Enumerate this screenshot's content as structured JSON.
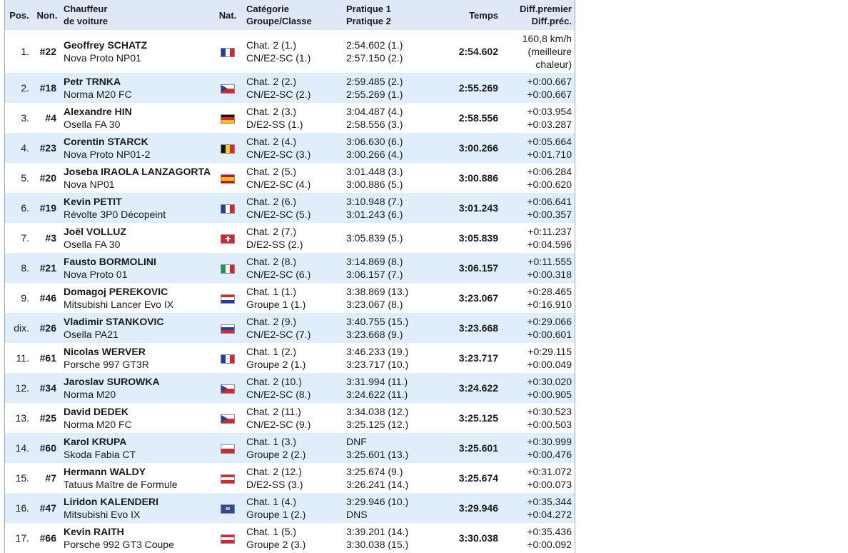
{
  "header": {
    "pos": "Pos.",
    "no": "Non.",
    "driver": "Chauffeur",
    "car": "de voiture",
    "nat": "Nat.",
    "category": "Catégorie",
    "group": "Groupe/Classe",
    "practice1": "Pratique 1",
    "practice2": "Pratique 2",
    "time": "Temps",
    "diff_first": "Diff.premier",
    "diff_prev": "Diff.préc."
  },
  "rows": [
    {
      "pos": "1.",
      "no": "#22",
      "driver": "Geoffrey SCHATZ",
      "car": "Nova Proto NP01",
      "flag": "fr",
      "cat": "Chat. 2 (1.)",
      "group": "CN/E2-SC (1.)",
      "p1": "2:54.602 (1.)",
      "p2": "2:57.150 (2.)",
      "time": "2:54.602",
      "diff1": "160,8 km/h",
      "diff2": "(meilleure",
      "diff3": "chaleur)"
    },
    {
      "pos": "2.",
      "no": "#18",
      "driver": "Petr TRNKA",
      "car": "Norma M20 FC",
      "flag": "cz",
      "cat": "Chat. 2 (2.)",
      "group": "CN/E2-SC (2.)",
      "p1": "2:59.485 (2.)",
      "p2": "2:55.269 (1.)",
      "time": "2:55.269",
      "diff1": "+0:00.667",
      "diff2": "+0:00.667"
    },
    {
      "pos": "3.",
      "no": "#4",
      "driver": "Alexandre HIN",
      "car": "Osella FA 30",
      "flag": "de",
      "cat": "Chat. 2 (3.)",
      "group": "D/E2-SS (1.)",
      "p1": "3:04.487 (4.)",
      "p2": "2:58.556 (3.)",
      "time": "2:58.556",
      "diff1": "+0:03.954",
      "diff2": "+0:03.287"
    },
    {
      "pos": "4.",
      "no": "#23",
      "driver": "Corentin STARCK",
      "car": "Nova Proto NP01-2",
      "flag": "be",
      "cat": "Chat. 2 (4.)",
      "group": "CN/E2-SC (3.)",
      "p1": "3:06.630 (6.)",
      "p2": "3:00.266 (4.)",
      "time": "3:00.266",
      "diff1": "+0:05.664",
      "diff2": "+0:01.710"
    },
    {
      "pos": "5.",
      "no": "#20",
      "driver": "Joseba IRAOLA LANZAGORTA",
      "car": "Nova NP01",
      "flag": "es",
      "cat": "Chat. 2 (5.)",
      "group": "CN/E2-SC (4.)",
      "p1": "3:01.448 (3.)",
      "p2": "3:00.886 (5.)",
      "time": "3:00.886",
      "diff1": "+0:06.284",
      "diff2": "+0:00.620"
    },
    {
      "pos": "6.",
      "no": "#19",
      "driver": "Kevin PETIT",
      "car": "Révolte 3P0 Décopeint",
      "flag": "fr",
      "cat": "Chat. 2 (6.)",
      "group": "CN/E2-SC (5.)",
      "p1": "3:10.948 (7.)",
      "p2": "3:01.243 (6.)",
      "time": "3:01.243",
      "diff1": "+0:06.641",
      "diff2": "+0:00.357"
    },
    {
      "pos": "7.",
      "no": "#3",
      "driver": "Joël VOLLUZ",
      "car": "Osella FA 30",
      "flag": "ch",
      "cat": "Chat. 2 (7.)",
      "group": "D/E2-SS (2.)",
      "p1": "3:05.839 (5.)",
      "p2": "",
      "time": "3:05.839",
      "diff1": "+0:11.237",
      "diff2": "+0:04.596"
    },
    {
      "pos": "8.",
      "no": "#21",
      "driver": "Fausto BORMOLINI",
      "car": "Nova Proto 01",
      "flag": "it",
      "cat": "Chat. 2 (8.)",
      "group": "CN/E2-SC (6.)",
      "p1": "3:14.869 (8.)",
      "p2": "3:06.157 (7.)",
      "time": "3:06.157",
      "diff1": "+0:11.555",
      "diff2": "+0:00.318"
    },
    {
      "pos": "9.",
      "no": "#46",
      "driver": "Domagoj PEREKOVIC",
      "car": "Mitsubishi Lancer Evo IX",
      "flag": "hr",
      "cat": "Chat. 1 (1.)",
      "group": "Groupe 1 (1.)",
      "p1": "3:38.869 (13.)",
      "p2": "3:23.067 (8.)",
      "time": "3:23.067",
      "diff1": "+0:28.465",
      "diff2": "+0:16.910"
    },
    {
      "pos": "dix.",
      "no": "#26",
      "driver": "Vladimir STANKOVIC",
      "car": "Osella PA21",
      "flag": "si",
      "cat": "Chat. 2 (9.)",
      "group": "CN/E2-SC (7.)",
      "p1": "3:40.755 (15.)",
      "p2": "3:23.668 (9.)",
      "time": "3:23.668",
      "diff1": "+0:29.066",
      "diff2": "+0:00.601"
    },
    {
      "pos": "11.",
      "no": "#61",
      "driver": "Nicolas WERVER",
      "car": "Porsche 997 GT3R",
      "flag": "fr",
      "cat": "Chat. 1 (2.)",
      "group": "Groupe 2 (1.)",
      "p1": "3:46.233 (19.)",
      "p2": "3:23.717 (10.)",
      "time": "3:23.717",
      "diff1": "+0:29.115",
      "diff2": "+0:00.049"
    },
    {
      "pos": "12.",
      "no": "#34",
      "driver": "Jaroslav SUROWKA",
      "car": "Norma M20",
      "flag": "cz",
      "cat": "Chat. 2 (10.)",
      "group": "CN/E2-SC (8.)",
      "p1": "3:31.994 (11.)",
      "p2": "3:24.622 (11.)",
      "time": "3:24.622",
      "diff1": "+0:30.020",
      "diff2": "+0:00.905"
    },
    {
      "pos": "13.",
      "no": "#25",
      "driver": "David DEDEK",
      "car": "Norma M20 FC",
      "flag": "cz",
      "cat": "Chat. 2 (11.)",
      "group": "CN/E2-SC (9.)",
      "p1": "3:34.038 (12.)",
      "p2": "3:25.125 (12.)",
      "time": "3:25.125",
      "diff1": "+0:30.523",
      "diff2": "+0:00.503"
    },
    {
      "pos": "14.",
      "no": "#60",
      "driver": "Karol KRUPA",
      "car": "Skoda Fabia CT",
      "flag": "pl",
      "cat": "Chat. 1 (3.)",
      "group": "Groupe 2 (2.)",
      "p1": "DNF",
      "p2": "3:25.601 (13.)",
      "time": "3:25.601",
      "diff1": "+0:30.999",
      "diff2": "+0:00.476"
    },
    {
      "pos": "15.",
      "no": "#7",
      "driver": "Hermann WALDY",
      "car": "Tatuus Maître de Formule",
      "flag": "at",
      "cat": "Chat. 2 (12.)",
      "group": "D/E2-SS (3.)",
      "p1": "3:25.674 (9.)",
      "p2": "3:26.241 (14.)",
      "time": "3:25.674",
      "diff1": "+0:31.072",
      "diff2": "+0:00.073"
    },
    {
      "pos": "16.",
      "no": "#47",
      "driver": "Liridon KALENDERI",
      "car": "Mitsubishi Evo IX",
      "flag": "xk",
      "cat": "Chat. 1 (4.)",
      "group": "Groupe 1 (2.)",
      "p1": "3:29.946 (10.)",
      "p2": "DNS",
      "time": "3:29.946",
      "diff1": "+0:35.344",
      "diff2": "+0:04.272"
    },
    {
      "pos": "17.",
      "no": "#66",
      "driver": "Kevin RAITH",
      "car": "Porsche 992 GT3 Coupe",
      "flag": "at",
      "cat": "Chat. 1 (5.)",
      "group": "Groupe 2 (3.)",
      "p1": "3:39.201 (14.)",
      "p2": "3:30.038 (15.)",
      "time": "3:30.038",
      "diff1": "+0:35.436",
      "diff2": "+0:00.092"
    }
  ]
}
